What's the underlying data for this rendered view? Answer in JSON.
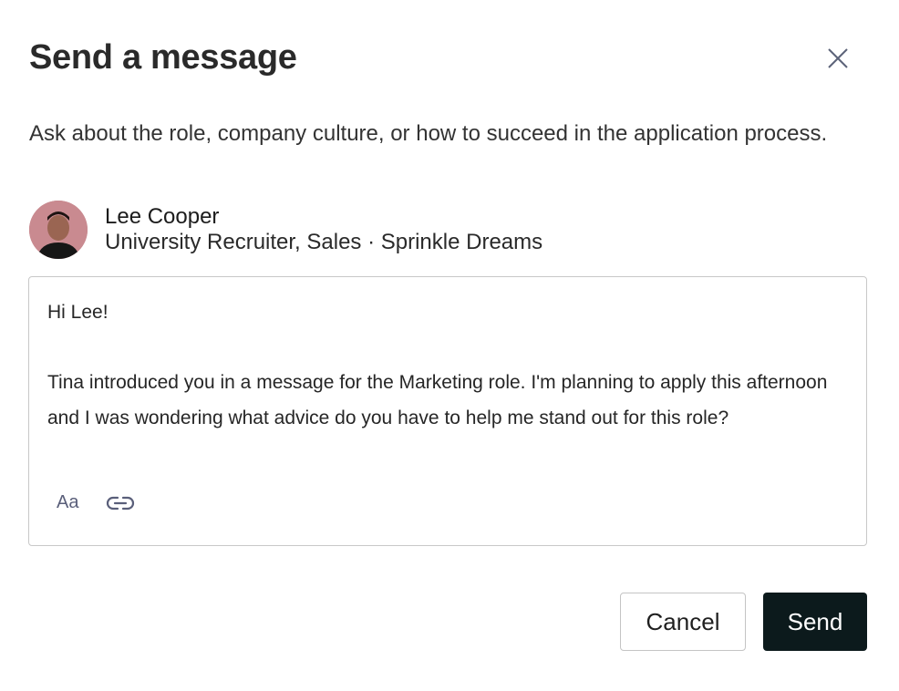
{
  "dialog": {
    "title": "Send a message",
    "description": "Ask about the role, company culture, or how to succeed in the application process."
  },
  "recipient": {
    "name": "Lee Cooper",
    "subtitle": "University Recruiter, Sales · Sprinkle Dreams"
  },
  "message": {
    "greeting": "Hi Lee!",
    "body": "Tina introduced you in a message for the Marketing role. I'm planning to apply this afternoon and I was wondering what advice do you have to help me stand out for this role?"
  },
  "toolbar": {
    "format_label": "Aa",
    "format_icon": "text-format-icon",
    "link_icon": "link-icon"
  },
  "actions": {
    "cancel_label": "Cancel",
    "send_label": "Send"
  },
  "colors": {
    "send_button_bg": "#0c1a1c",
    "toolbar_icon": "#5a5f7a",
    "border": "#c8c8c8"
  }
}
